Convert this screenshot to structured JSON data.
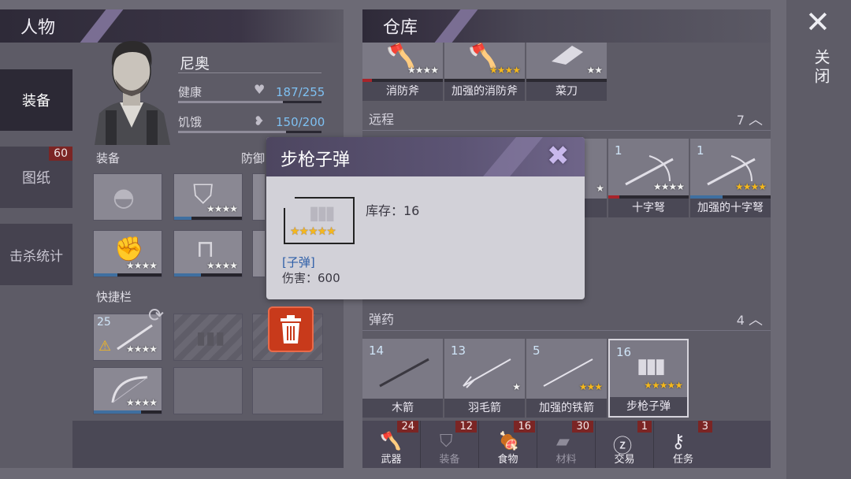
{
  "character_panel": {
    "title": "人物",
    "tabs": [
      {
        "label": "装备",
        "active": true
      },
      {
        "label": "图纸",
        "badge": "60"
      },
      {
        "label": "击杀统计"
      }
    ],
    "name": "尼奥",
    "stats": {
      "health_label": "健康",
      "health_value": "187/255",
      "health_fraction": 0.733,
      "hunger_label": "饥饿",
      "hunger_value": "150/200",
      "hunger_fraction": 0.75
    },
    "equipment_label": "装备",
    "defense_label": "防御",
    "hotbar_label": "快捷栏",
    "hotbar_first_count": "25"
  },
  "warehouse": {
    "title": "仓库",
    "melee_items": [
      {
        "label": "消防斧",
        "icon": "fire-axe-icon"
      },
      {
        "label": "加强的消防斧",
        "icon": "fire-axe-icon",
        "gold": true
      },
      {
        "label": "菜刀",
        "icon": "cleaver-icon"
      }
    ],
    "ranged_section": {
      "label": "远程",
      "count": "7"
    },
    "ranged_items": [
      {
        "count": "1",
        "label": "十字弩",
        "icon": "crossbow-icon"
      },
      {
        "count": "1",
        "label": "加强的十字弩",
        "icon": "crossbow-icon",
        "gold": true
      }
    ],
    "ammo_section": {
      "label": "弹药",
      "count": "4"
    },
    "ammo_items": [
      {
        "count": "14",
        "label": "木箭",
        "icon": "arrow-icon"
      },
      {
        "count": "13",
        "label": "羽毛箭",
        "icon": "feather-arrow-icon"
      },
      {
        "count": "5",
        "label": "加强的铁箭",
        "icon": "arrow-icon",
        "gold": true
      },
      {
        "count": "16",
        "label": "步枪子弹",
        "icon": "bullets-icon",
        "gold": true
      }
    ],
    "categories": [
      {
        "label": "武器",
        "badge": "24",
        "icon": "axe-icon"
      },
      {
        "label": "装备",
        "badge": "12",
        "icon": "shirt-icon"
      },
      {
        "label": "食物",
        "badge": "16",
        "icon": "food-icon"
      },
      {
        "label": "材料",
        "badge": "30",
        "icon": "materials-icon"
      },
      {
        "label": "交易",
        "badge": "1",
        "icon": "coin-icon"
      },
      {
        "label": "任务",
        "badge": "3",
        "icon": "key-icon"
      }
    ]
  },
  "close": {
    "label": "关闭"
  },
  "dialog": {
    "title": "步枪子弹",
    "stock_label": "库存：16",
    "type_label": "[子弹]",
    "damage_label": "伤害：600"
  },
  "colors": {
    "accent_purple": "#5c5474",
    "badge_red": "#7b2524",
    "stat_blue": "#7ec0f2",
    "star_gold": "#f5b81d",
    "delete_red": "#c83a1b"
  }
}
